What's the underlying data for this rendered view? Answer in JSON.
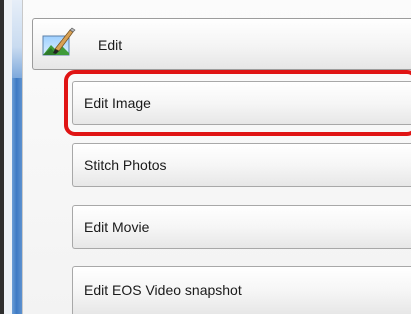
{
  "header": {
    "label": "Edit",
    "icon": "edit-image-brush-icon"
  },
  "items": [
    {
      "label": "Edit Image"
    },
    {
      "label": "Stitch Photos"
    },
    {
      "label": "Edit Movie"
    },
    {
      "label": "Edit EOS Video snapshot"
    }
  ],
  "selected_item": "Edit Image",
  "colors": {
    "highlight": "#e01414",
    "strip": "#3d79c4"
  }
}
